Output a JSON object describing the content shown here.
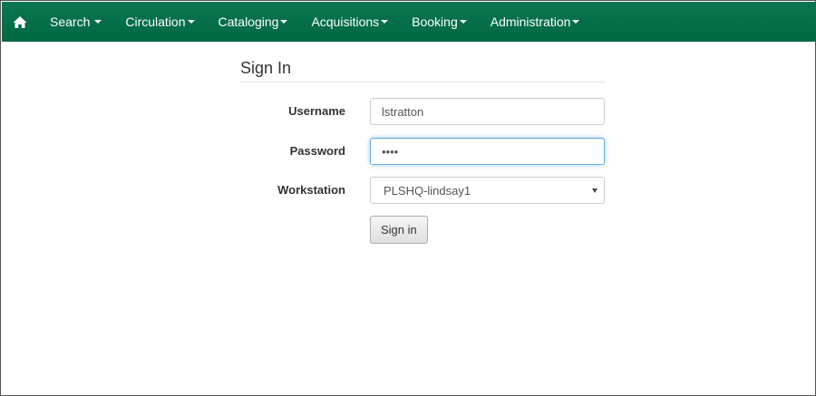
{
  "nav": {
    "home_icon": "home-icon",
    "items": [
      {
        "label": "Search"
      },
      {
        "label": "Circulation"
      },
      {
        "label": "Cataloging"
      },
      {
        "label": "Acquisitions"
      },
      {
        "label": "Booking"
      },
      {
        "label": "Administration"
      }
    ],
    "bg_color": "#006843"
  },
  "signin": {
    "title": "Sign In",
    "username_label": "Username",
    "username_value": "lstratton",
    "password_label": "Password",
    "password_value": "••••",
    "workstation_label": "Workstation",
    "workstation_value": "PLSHQ-lindsay1",
    "submit_label": "Sign in"
  }
}
